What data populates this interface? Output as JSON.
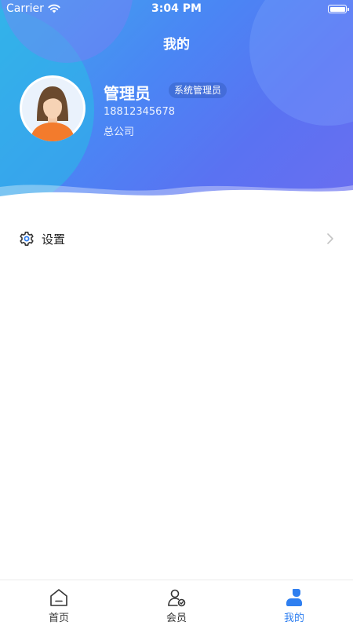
{
  "status_bar": {
    "carrier": "Carrier",
    "time": "3:04 PM"
  },
  "header": {
    "title": "我的"
  },
  "profile": {
    "name": "管理员",
    "role": "系统管理员",
    "phone": "18812345678",
    "organization": "总公司"
  },
  "menu": {
    "items": [
      {
        "label": "设置",
        "icon": "gear-icon"
      }
    ]
  },
  "tab_bar": {
    "items": [
      {
        "label": "首页",
        "icon": "home-icon",
        "active": false
      },
      {
        "label": "会员",
        "icon": "member-icon",
        "active": false
      },
      {
        "label": "我的",
        "icon": "profile-icon",
        "active": true
      }
    ]
  },
  "colors": {
    "accent": "#2f7ff0",
    "hero_start": "#3fa8ee",
    "hero_end": "#6a6ef0"
  }
}
